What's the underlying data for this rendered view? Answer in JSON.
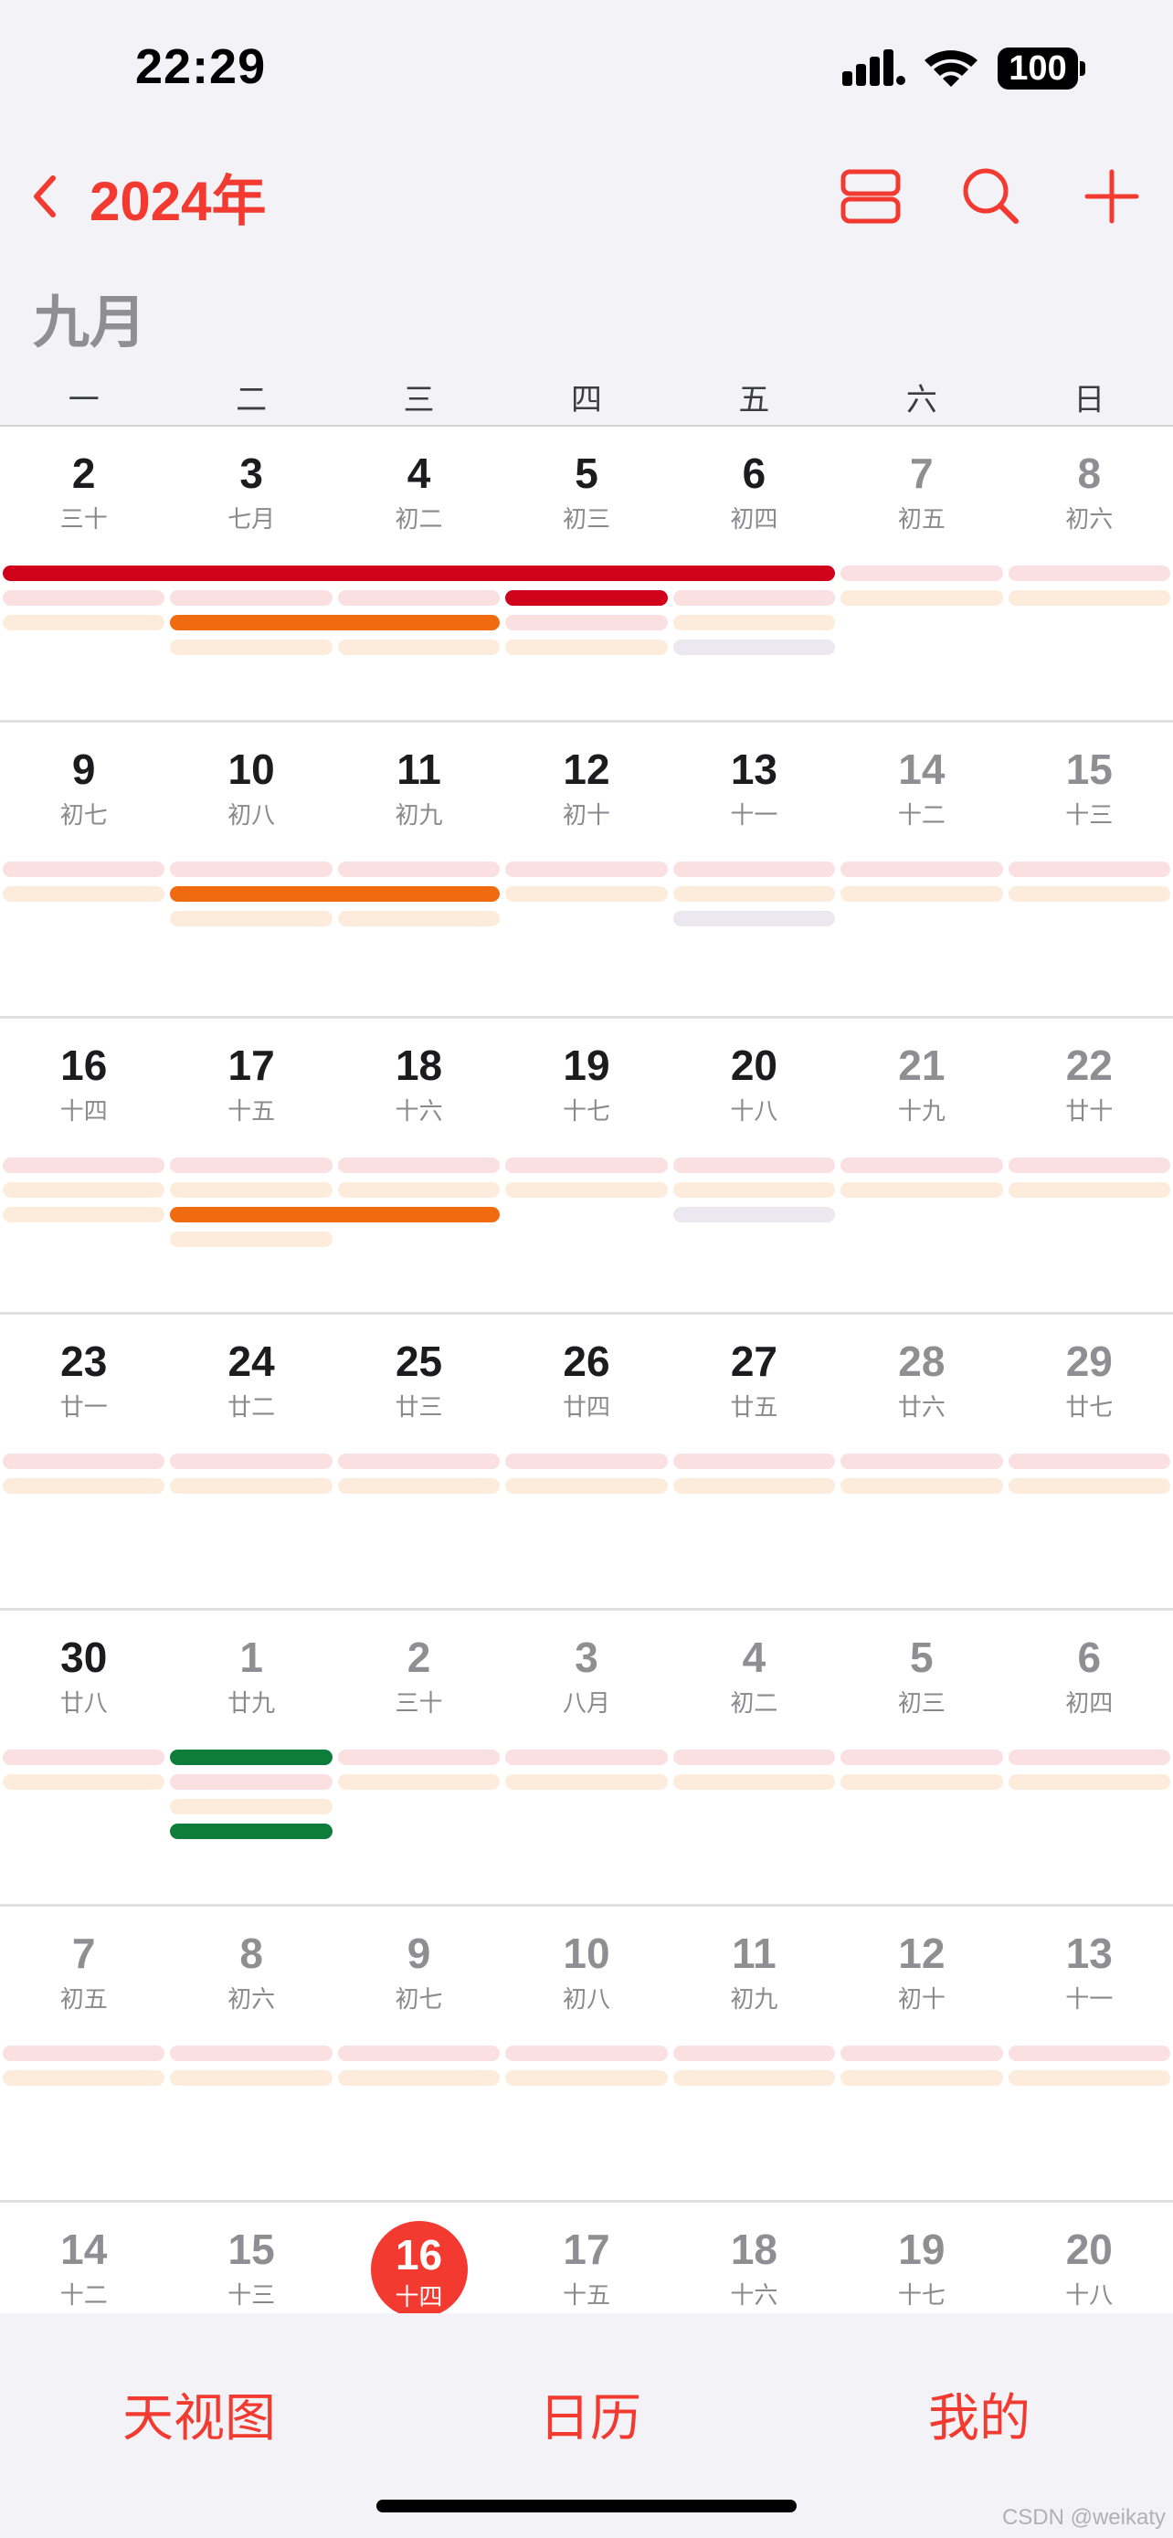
{
  "status_bar": {
    "time": "22:29",
    "battery": "100"
  },
  "nav": {
    "year_title": "2024年"
  },
  "calendar": {
    "month_title": "九月",
    "weekdays": [
      "一",
      "二",
      "三",
      "四",
      "五",
      "六",
      "日"
    ],
    "weeks": [
      [
        {
          "day": "2",
          "lunar": "三十"
        },
        {
          "day": "3",
          "lunar": "七月"
        },
        {
          "day": "4",
          "lunar": "初二"
        },
        {
          "day": "5",
          "lunar": "初三"
        },
        {
          "day": "6",
          "lunar": "初四"
        },
        {
          "day": "7",
          "lunar": "初五"
        },
        {
          "day": "8",
          "lunar": "初六"
        }
      ],
      [
        {
          "day": "9",
          "lunar": "初七"
        },
        {
          "day": "10",
          "lunar": "初八"
        },
        {
          "day": "11",
          "lunar": "初九"
        },
        {
          "day": "12",
          "lunar": "初十"
        },
        {
          "day": "13",
          "lunar": "十一"
        },
        {
          "day": "14",
          "lunar": "十二"
        },
        {
          "day": "15",
          "lunar": "十三"
        }
      ],
      [
        {
          "day": "16",
          "lunar": "十四"
        },
        {
          "day": "17",
          "lunar": "十五"
        },
        {
          "day": "18",
          "lunar": "十六"
        },
        {
          "day": "19",
          "lunar": "十七"
        },
        {
          "day": "20",
          "lunar": "十八"
        },
        {
          "day": "21",
          "lunar": "十九"
        },
        {
          "day": "22",
          "lunar": "廿十"
        }
      ],
      [
        {
          "day": "23",
          "lunar": "廿一"
        },
        {
          "day": "24",
          "lunar": "廿二"
        },
        {
          "day": "25",
          "lunar": "廿三"
        },
        {
          "day": "26",
          "lunar": "廿四"
        },
        {
          "day": "27",
          "lunar": "廿五"
        },
        {
          "day": "28",
          "lunar": "廿六"
        },
        {
          "day": "29",
          "lunar": "廿七"
        }
      ],
      [
        {
          "day": "30",
          "lunar": "廿八"
        },
        {
          "day": "1",
          "lunar": "廿九"
        },
        {
          "day": "2",
          "lunar": "三十"
        },
        {
          "day": "3",
          "lunar": "八月"
        },
        {
          "day": "4",
          "lunar": "初二"
        },
        {
          "day": "5",
          "lunar": "初三"
        },
        {
          "day": "6",
          "lunar": "初四"
        }
      ],
      [
        {
          "day": "7",
          "lunar": "初五"
        },
        {
          "day": "8",
          "lunar": "初六"
        },
        {
          "day": "9",
          "lunar": "初七"
        },
        {
          "day": "10",
          "lunar": "初八"
        },
        {
          "day": "11",
          "lunar": "初九"
        },
        {
          "day": "12",
          "lunar": "初十"
        },
        {
          "day": "13",
          "lunar": "十一"
        }
      ],
      [
        {
          "day": "14",
          "lunar": "十二"
        },
        {
          "day": "15",
          "lunar": "十三"
        },
        {
          "day": "16",
          "lunar": "十四"
        },
        {
          "day": "17",
          "lunar": "十五"
        },
        {
          "day": "18",
          "lunar": "十六"
        },
        {
          "day": "19",
          "lunar": "十七"
        },
        {
          "day": "20",
          "lunar": "十八"
        }
      ]
    ],
    "today": {
      "week": 6,
      "weekday": 2
    },
    "event_colors": {
      "red": "#d0021b",
      "orange": "#f06a0f",
      "green": "#0e7c3a",
      "pink": "#fae0e0",
      "peach": "#fdebdc",
      "lavender": "#ece8f0"
    },
    "events": [
      {
        "week": 0,
        "lane": 0,
        "start": 0,
        "span": 5,
        "color": "red"
      },
      {
        "week": 0,
        "lane": 0,
        "start": 5,
        "span": 1,
        "color": "pink"
      },
      {
        "week": 0,
        "lane": 0,
        "start": 6,
        "span": 1,
        "color": "pink"
      },
      {
        "week": 0,
        "lane": 1,
        "start": 0,
        "span": 1,
        "color": "pink"
      },
      {
        "week": 0,
        "lane": 1,
        "start": 1,
        "span": 1,
        "color": "pink"
      },
      {
        "week": 0,
        "lane": 1,
        "start": 2,
        "span": 1,
        "color": "pink"
      },
      {
        "week": 0,
        "lane": 1,
        "start": 3,
        "span": 1,
        "color": "red"
      },
      {
        "week": 0,
        "lane": 1,
        "start": 4,
        "span": 1,
        "color": "pink"
      },
      {
        "week": 0,
        "lane": 1,
        "start": 5,
        "span": 1,
        "color": "peach"
      },
      {
        "week": 0,
        "lane": 1,
        "start": 6,
        "span": 1,
        "color": "peach"
      },
      {
        "week": 0,
        "lane": 2,
        "start": 0,
        "span": 1,
        "color": "peach"
      },
      {
        "week": 0,
        "lane": 2,
        "start": 1,
        "span": 2,
        "color": "orange"
      },
      {
        "week": 0,
        "lane": 2,
        "start": 3,
        "span": 1,
        "color": "pink"
      },
      {
        "week": 0,
        "lane": 2,
        "start": 4,
        "span": 1,
        "color": "peach"
      },
      {
        "week": 0,
        "lane": 3,
        "start": 1,
        "span": 1,
        "color": "peach"
      },
      {
        "week": 0,
        "lane": 3,
        "start": 2,
        "span": 1,
        "color": "peach"
      },
      {
        "week": 0,
        "lane": 3,
        "start": 3,
        "span": 1,
        "color": "peach"
      },
      {
        "week": 0,
        "lane": 3,
        "start": 4,
        "span": 1,
        "color": "lavender"
      },
      {
        "week": 1,
        "lane": 0,
        "start": 0,
        "span": 1,
        "color": "pink"
      },
      {
        "week": 1,
        "lane": 0,
        "start": 1,
        "span": 1,
        "color": "pink"
      },
      {
        "week": 1,
        "lane": 0,
        "start": 2,
        "span": 1,
        "color": "pink"
      },
      {
        "week": 1,
        "lane": 0,
        "start": 3,
        "span": 1,
        "color": "pink"
      },
      {
        "week": 1,
        "lane": 0,
        "start": 4,
        "span": 1,
        "color": "pink"
      },
      {
        "week": 1,
        "lane": 0,
        "start": 5,
        "span": 1,
        "color": "pink"
      },
      {
        "week": 1,
        "lane": 0,
        "start": 6,
        "span": 1,
        "color": "pink"
      },
      {
        "week": 1,
        "lane": 1,
        "start": 0,
        "span": 1,
        "color": "peach"
      },
      {
        "week": 1,
        "lane": 1,
        "start": 1,
        "span": 2,
        "color": "orange"
      },
      {
        "week": 1,
        "lane": 1,
        "start": 3,
        "span": 1,
        "color": "peach"
      },
      {
        "week": 1,
        "lane": 1,
        "start": 4,
        "span": 1,
        "color": "peach"
      },
      {
        "week": 1,
        "lane": 1,
        "start": 5,
        "span": 1,
        "color": "peach"
      },
      {
        "week": 1,
        "lane": 1,
        "start": 6,
        "span": 1,
        "color": "peach"
      },
      {
        "week": 1,
        "lane": 2,
        "start": 1,
        "span": 1,
        "color": "peach"
      },
      {
        "week": 1,
        "lane": 2,
        "start": 2,
        "span": 1,
        "color": "peach"
      },
      {
        "week": 1,
        "lane": 2,
        "start": 4,
        "span": 1,
        "color": "lavender"
      },
      {
        "week": 2,
        "lane": 0,
        "start": 0,
        "span": 1,
        "color": "pink"
      },
      {
        "week": 2,
        "lane": 0,
        "start": 1,
        "span": 1,
        "color": "pink"
      },
      {
        "week": 2,
        "lane": 0,
        "start": 2,
        "span": 1,
        "color": "pink"
      },
      {
        "week": 2,
        "lane": 0,
        "start": 3,
        "span": 1,
        "color": "pink"
      },
      {
        "week": 2,
        "lane": 0,
        "start": 4,
        "span": 1,
        "color": "pink"
      },
      {
        "week": 2,
        "lane": 0,
        "start": 5,
        "span": 1,
        "color": "pink"
      },
      {
        "week": 2,
        "lane": 0,
        "start": 6,
        "span": 1,
        "color": "pink"
      },
      {
        "week": 2,
        "lane": 1,
        "start": 0,
        "span": 1,
        "color": "peach"
      },
      {
        "week": 2,
        "lane": 1,
        "start": 1,
        "span": 1,
        "color": "peach"
      },
      {
        "week": 2,
        "lane": 1,
        "start": 2,
        "span": 1,
        "color": "peach"
      },
      {
        "week": 2,
        "lane": 1,
        "start": 3,
        "span": 1,
        "color": "peach"
      },
      {
        "week": 2,
        "lane": 1,
        "start": 4,
        "span": 1,
        "color": "peach"
      },
      {
        "week": 2,
        "lane": 1,
        "start": 5,
        "span": 1,
        "color": "peach"
      },
      {
        "week": 2,
        "lane": 1,
        "start": 6,
        "span": 1,
        "color": "peach"
      },
      {
        "week": 2,
        "lane": 2,
        "start": 0,
        "span": 1,
        "color": "peach"
      },
      {
        "week": 2,
        "lane": 2,
        "start": 1,
        "span": 2,
        "color": "orange"
      },
      {
        "week": 2,
        "lane": 2,
        "start": 4,
        "span": 1,
        "color": "lavender"
      },
      {
        "week": 2,
        "lane": 3,
        "start": 1,
        "span": 1,
        "color": "peach"
      },
      {
        "week": 3,
        "lane": 0,
        "start": 0,
        "span": 1,
        "color": "pink"
      },
      {
        "week": 3,
        "lane": 0,
        "start": 1,
        "span": 1,
        "color": "pink"
      },
      {
        "week": 3,
        "lane": 0,
        "start": 2,
        "span": 1,
        "color": "pink"
      },
      {
        "week": 3,
        "lane": 0,
        "start": 3,
        "span": 1,
        "color": "pink"
      },
      {
        "week": 3,
        "lane": 0,
        "start": 4,
        "span": 1,
        "color": "pink"
      },
      {
        "week": 3,
        "lane": 0,
        "start": 5,
        "span": 1,
        "color": "pink"
      },
      {
        "week": 3,
        "lane": 0,
        "start": 6,
        "span": 1,
        "color": "pink"
      },
      {
        "week": 3,
        "lane": 1,
        "start": 0,
        "span": 1,
        "color": "peach"
      },
      {
        "week": 3,
        "lane": 1,
        "start": 1,
        "span": 1,
        "color": "peach"
      },
      {
        "week": 3,
        "lane": 1,
        "start": 2,
        "span": 1,
        "color": "peach"
      },
      {
        "week": 3,
        "lane": 1,
        "start": 3,
        "span": 1,
        "color": "peach"
      },
      {
        "week": 3,
        "lane": 1,
        "start": 4,
        "span": 1,
        "color": "peach"
      },
      {
        "week": 3,
        "lane": 1,
        "start": 5,
        "span": 1,
        "color": "peach"
      },
      {
        "week": 3,
        "lane": 1,
        "start": 6,
        "span": 1,
        "color": "peach"
      },
      {
        "week": 4,
        "lane": 0,
        "start": 0,
        "span": 1,
        "color": "pink"
      },
      {
        "week": 4,
        "lane": 0,
        "start": 1,
        "span": 1,
        "color": "green"
      },
      {
        "week": 4,
        "lane": 0,
        "start": 2,
        "span": 1,
        "color": "pink"
      },
      {
        "week": 4,
        "lane": 0,
        "start": 3,
        "span": 1,
        "color": "pink"
      },
      {
        "week": 4,
        "lane": 0,
        "start": 4,
        "span": 1,
        "color": "pink"
      },
      {
        "week": 4,
        "lane": 0,
        "start": 5,
        "span": 1,
        "color": "pink"
      },
      {
        "week": 4,
        "lane": 0,
        "start": 6,
        "span": 1,
        "color": "pink"
      },
      {
        "week": 4,
        "lane": 1,
        "start": 0,
        "span": 1,
        "color": "peach"
      },
      {
        "week": 4,
        "lane": 1,
        "start": 1,
        "span": 1,
        "color": "pink"
      },
      {
        "week": 4,
        "lane": 1,
        "start": 2,
        "span": 1,
        "color": "peach"
      },
      {
        "week": 4,
        "lane": 1,
        "start": 3,
        "span": 1,
        "color": "peach"
      },
      {
        "week": 4,
        "lane": 1,
        "start": 4,
        "span": 1,
        "color": "peach"
      },
      {
        "week": 4,
        "lane": 1,
        "start": 5,
        "span": 1,
        "color": "peach"
      },
      {
        "week": 4,
        "lane": 1,
        "start": 6,
        "span": 1,
        "color": "peach"
      },
      {
        "week": 4,
        "lane": 2,
        "start": 1,
        "span": 1,
        "color": "peach"
      },
      {
        "week": 4,
        "lane": 3,
        "start": 1,
        "span": 1,
        "color": "green"
      },
      {
        "week": 5,
        "lane": 0,
        "start": 0,
        "span": 1,
        "color": "pink"
      },
      {
        "week": 5,
        "lane": 0,
        "start": 1,
        "span": 1,
        "color": "pink"
      },
      {
        "week": 5,
        "lane": 0,
        "start": 2,
        "span": 1,
        "color": "pink"
      },
      {
        "week": 5,
        "lane": 0,
        "start": 3,
        "span": 1,
        "color": "pink"
      },
      {
        "week": 5,
        "lane": 0,
        "start": 4,
        "span": 1,
        "color": "pink"
      },
      {
        "week": 5,
        "lane": 0,
        "start": 5,
        "span": 1,
        "color": "pink"
      },
      {
        "week": 5,
        "lane": 0,
        "start": 6,
        "span": 1,
        "color": "pink"
      },
      {
        "week": 5,
        "lane": 1,
        "start": 0,
        "span": 1,
        "color": "peach"
      },
      {
        "week": 5,
        "lane": 1,
        "start": 1,
        "span": 1,
        "color": "peach"
      },
      {
        "week": 5,
        "lane": 1,
        "start": 2,
        "span": 1,
        "color": "peach"
      },
      {
        "week": 5,
        "lane": 1,
        "start": 3,
        "span": 1,
        "color": "peach"
      },
      {
        "week": 5,
        "lane": 1,
        "start": 4,
        "span": 1,
        "color": "peach"
      },
      {
        "week": 5,
        "lane": 1,
        "start": 5,
        "span": 1,
        "color": "peach"
      },
      {
        "week": 5,
        "lane": 1,
        "start": 6,
        "span": 1,
        "color": "peach"
      }
    ]
  },
  "tab_bar": {
    "tabs": [
      "天视图",
      "日历",
      "我的"
    ]
  },
  "watermark": "CSDN @weikaty"
}
